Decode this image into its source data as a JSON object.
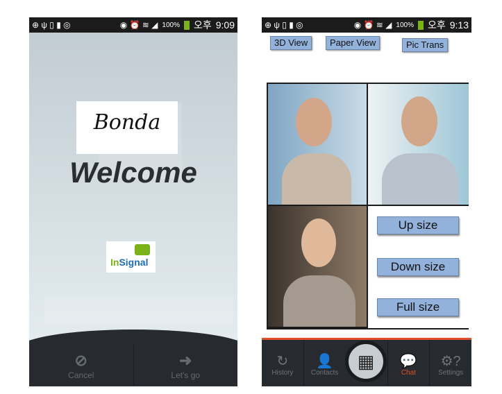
{
  "left": {
    "status": {
      "battery": "100%",
      "period": "오후",
      "time": "9:09"
    },
    "name_label": "Bonda",
    "welcome": "Welcome",
    "logo": {
      "in": "In",
      "signal": "Signal"
    },
    "buttons": [
      {
        "label": "Cancel",
        "icon": "cancel-icon"
      },
      {
        "label": "Let's go",
        "icon": "arrow-right-icon"
      }
    ]
  },
  "right": {
    "status": {
      "battery": "100%",
      "period": "오후",
      "time": "9:13"
    },
    "tabs": [
      "3D View",
      "Paper View",
      "Pic Trans"
    ],
    "size_buttons": [
      "Up size",
      "Down size",
      "Full size"
    ],
    "nav": [
      {
        "label": "History",
        "icon": "history-icon"
      },
      {
        "label": "Contacts",
        "icon": "contacts-icon"
      },
      {
        "label": "Chat",
        "icon": "chat-icon",
        "active": true
      },
      {
        "label": "Settings",
        "icon": "settings-icon"
      }
    ],
    "accent": "#e4502a"
  }
}
